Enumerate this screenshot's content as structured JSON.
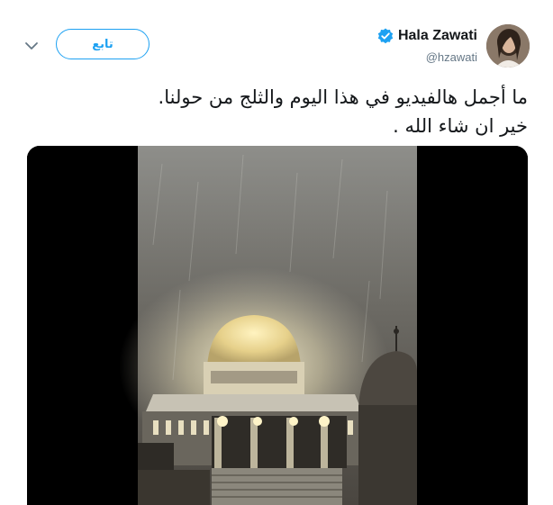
{
  "header": {
    "follow_label": "تابع",
    "display_name": "Hala Zawati",
    "handle": "@hzawati"
  },
  "icons": {
    "chevron": "chevron-down-icon",
    "verified": "verified-badge-icon",
    "avatar": "profile-avatar"
  },
  "tweet": {
    "lines": [
      "ما أجمل هالفيديو في هذا اليوم والثلج من حولنا.",
      "خير ان شاء الله ."
    ]
  },
  "colors": {
    "accent": "#1da1f2",
    "text": "#14171a",
    "muted": "#657786",
    "media_bg": "#000000"
  }
}
